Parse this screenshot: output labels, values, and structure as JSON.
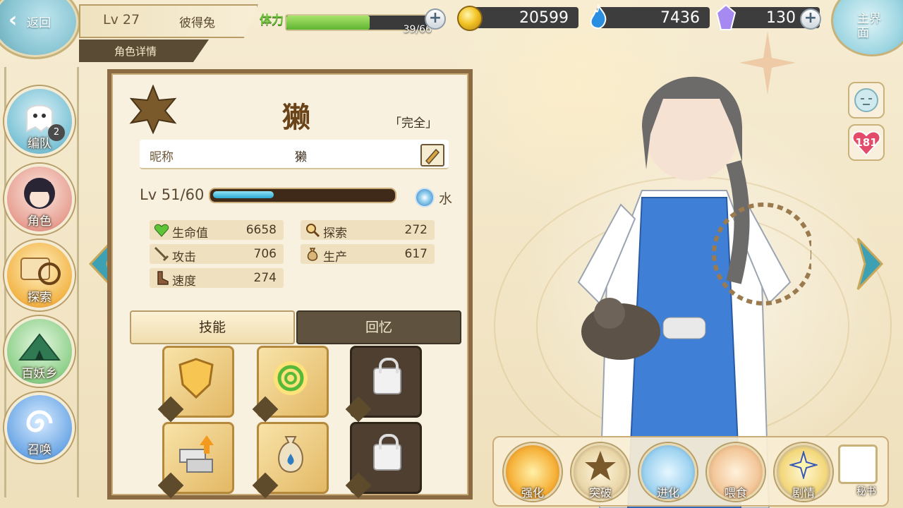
{
  "topbar": {
    "back_label": "返回",
    "level": "Lv 27",
    "player_name": "彼得兔",
    "section_tab": "角色详情",
    "stamina_label": "体力",
    "stamina_value": "39/66",
    "stamina_fraction": 0.59,
    "gold": "20599",
    "spirit": "7436",
    "gems": "130",
    "home_label": "主界面"
  },
  "sidebar": {
    "items": [
      {
        "label": "编队",
        "badge": "2"
      },
      {
        "label": "角色"
      },
      {
        "label": "探索"
      },
      {
        "label": "百妖乡"
      },
      {
        "label": "召唤"
      }
    ]
  },
  "character": {
    "name": "獭",
    "state": "「完全」",
    "nick_key": "昵称",
    "nick_value": "獭",
    "level": "Lv 51/60",
    "level_fraction": 0.33,
    "element": "水",
    "stats": [
      {
        "key": "生命值",
        "value": "6658",
        "icon": "heart-icon"
      },
      {
        "key": "探索",
        "value": "272",
        "icon": "magnifier-icon"
      },
      {
        "key": "攻击",
        "value": "706",
        "icon": "sword-icon"
      },
      {
        "key": "生产",
        "value": "617",
        "icon": "sack-icon"
      },
      {
        "key": "速度",
        "value": "274",
        "icon": "boot-icon"
      }
    ]
  },
  "tabs": {
    "skills": "技能",
    "memories": "回忆"
  },
  "right": {
    "affection": "181"
  },
  "actions": [
    {
      "label": "强化"
    },
    {
      "label": "突破"
    },
    {
      "label": "进化"
    },
    {
      "label": "喂食"
    },
    {
      "label": "剧情"
    }
  ],
  "secretary_label": "秘书",
  "colors": {
    "accent": "#b79e68",
    "panel": "#8a6b43",
    "water": "#2f7dc1"
  }
}
